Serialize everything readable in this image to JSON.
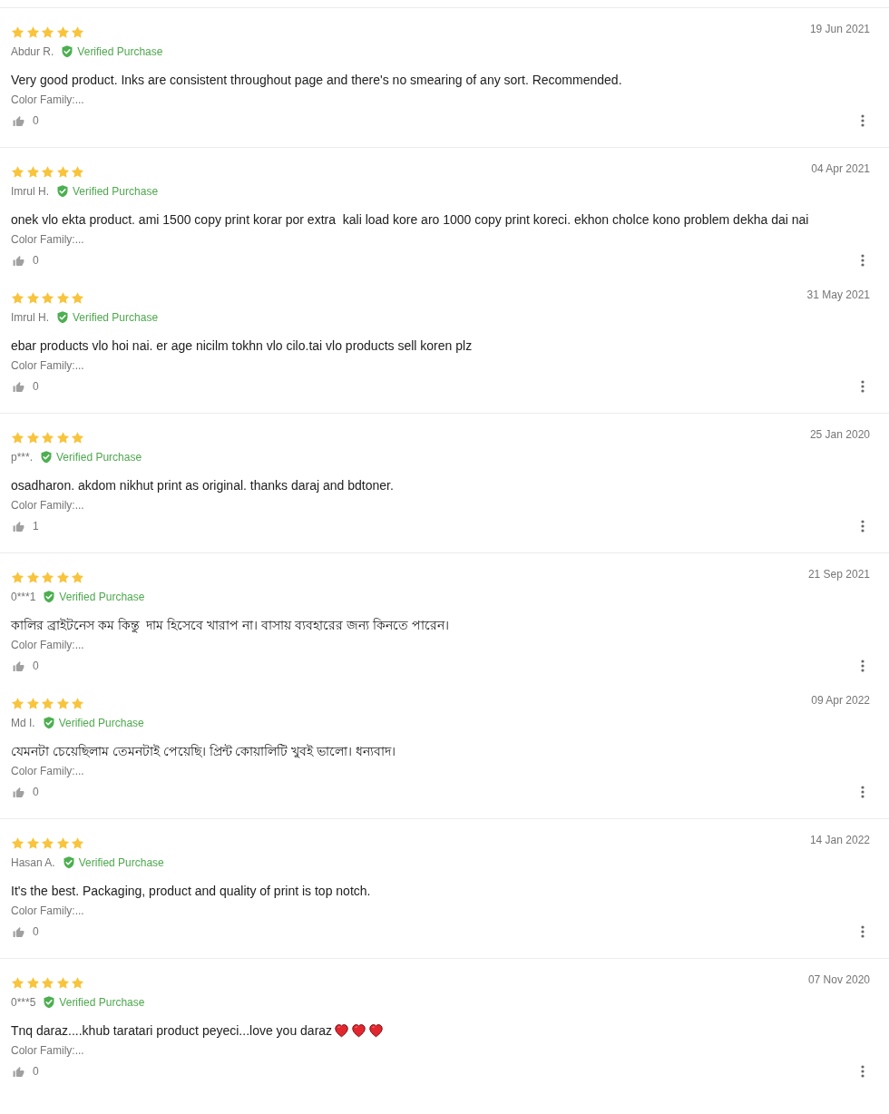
{
  "reviews": [
    {
      "divider": true,
      "stars": 5,
      "author": "Abdur R.",
      "verified": true,
      "verified_label": "Verified Purchase",
      "date": "19 Jun 2021",
      "text": "Very good product. Inks are consistent throughout page and there's no smearing of any sort. Recommended.",
      "sku": "Color Family:...",
      "likes": "0"
    },
    {
      "divider": true,
      "stars": 5,
      "author": "Imrul H.",
      "verified": true,
      "verified_label": "Verified Purchase",
      "date": "04 Apr 2021",
      "text": "onek vlo ekta product. ami 1500 copy print korar por extra  kali load kore aro 1000 copy print koreci. ekhon cholce kono problem dekha dai nai",
      "sku": "Color Family:...",
      "likes": "0"
    },
    {
      "divider": false,
      "stars": 5,
      "author": "Imrul H.",
      "verified": true,
      "verified_label": "Verified Purchase",
      "date": "31 May 2021",
      "text": "ebar products vlo hoi nai. er age nicilm tokhn vlo cilo.tai vlo products sell koren plz",
      "sku": "Color Family:...",
      "likes": "0"
    },
    {
      "divider": true,
      "stars": 5,
      "author": "p***.",
      "verified": true,
      "verified_label": "Verified Purchase",
      "date": "25 Jan 2020",
      "text": "osadharon. akdom nikhut print as original. thanks daraj and bdtoner.",
      "sku": "Color Family:...",
      "likes": "1"
    },
    {
      "divider": true,
      "stars": 5,
      "author": "0***1",
      "verified": true,
      "verified_label": "Verified Purchase",
      "date": "21 Sep 2021",
      "text": "কালির ব্রাইটনেস কম কিন্তু  দাম হিসেবে খারাপ না। বাসায় ব্যবহারের জন্য কিনতে পারেন।",
      "sku": "Color Family:...",
      "likes": "0"
    },
    {
      "divider": false,
      "stars": 5,
      "author": "Md I.",
      "verified": true,
      "verified_label": "Verified Purchase",
      "date": "09 Apr 2022",
      "text": "যেমনটা চেয়েছিলাম তেমনটাই পেয়েছি। প্রিন্ট কোয়ালিটি খুবই ভালো। ধন্যবাদ।",
      "sku": "Color Family:...",
      "likes": "0"
    },
    {
      "divider": true,
      "stars": 5,
      "author": "Hasan A.",
      "verified": true,
      "verified_label": "Verified Purchase",
      "date": "14 Jan 2022",
      "text": "It's the best. Packaging, product and quality of print is top notch.",
      "sku": "Color Family:...",
      "likes": "0"
    },
    {
      "divider": true,
      "stars": 5,
      "author": "0***5",
      "verified": true,
      "verified_label": "Verified Purchase",
      "date": "07 Nov 2020",
      "text": "Tnq daraz....khub taratari product peyeci...love you daraz",
      "icons": [
        {
          "kind": "heart"
        },
        {
          "kind": "heart"
        },
        {
          "kind": "heart"
        }
      ],
      "sku": "Color Family:...",
      "likes": "0"
    }
  ]
}
